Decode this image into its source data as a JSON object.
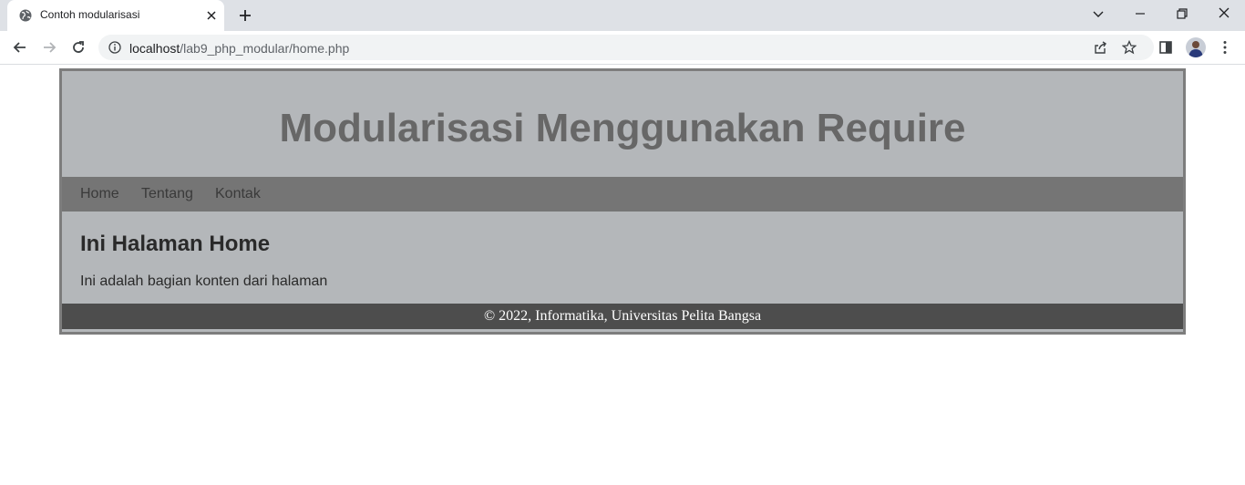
{
  "browser": {
    "tab_title": "Contoh modularisasi",
    "url_host": "localhost",
    "url_path": "/lab9_php_modular/home.php"
  },
  "page": {
    "header_title": "Modularisasi Menggunakan Require",
    "nav": [
      {
        "label": "Home"
      },
      {
        "label": "Tentang"
      },
      {
        "label": "Kontak"
      }
    ],
    "content_heading": "Ini Halaman Home",
    "content_text": "Ini adalah bagian konten dari halaman",
    "footer": "© 2022, Informatika, Universitas Pelita Bangsa"
  },
  "icons": {
    "favicon": "globe-icon",
    "tab_close": "close-icon",
    "new_tab": "plus-icon",
    "back": "arrow-left-icon",
    "forward": "arrow-right-icon",
    "reload": "reload-icon",
    "site_info": "info-icon",
    "share": "share-icon",
    "bookmark": "star-icon",
    "side_panel": "side-panel-icon",
    "menu": "kebab-menu-icon"
  },
  "colors": {
    "header_bg": "#b4b7ba",
    "nav_bg": "#757575",
    "footer_bg": "#4d4d4d",
    "title_color": "#676767"
  }
}
